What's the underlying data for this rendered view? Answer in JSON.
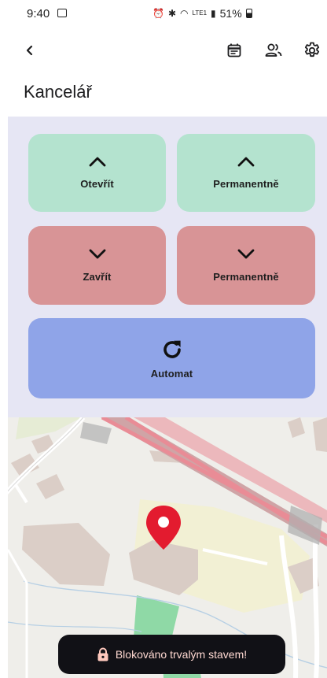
{
  "status_bar": {
    "time": "9:40",
    "battery": "51%",
    "network": "LTE1"
  },
  "app_bar": {
    "back_icon": "chevron-left-icon",
    "actions": [
      "calendar-icon",
      "people-icon",
      "gear-icon"
    ]
  },
  "page": {
    "title": "Kancelář"
  },
  "controls": {
    "open": {
      "label": "Otevřít",
      "icon": "chevron-up-icon"
    },
    "open_permanent": {
      "label": "Permanentně",
      "icon": "chevron-up-icon"
    },
    "close": {
      "label": "Zavřít",
      "icon": "chevron-down-icon"
    },
    "close_permanent": {
      "label": "Permanentně",
      "icon": "chevron-down-icon"
    },
    "automat": {
      "label": "Automat",
      "icon": "refresh-icon"
    }
  },
  "colors": {
    "open": "#b4e3cf",
    "close": "#d89496",
    "automat": "#8fa4e8",
    "panel": "#e6e6f4",
    "map_pin": "#e31b2f"
  },
  "toast": {
    "icon": "lock-icon",
    "text": "Blokováno trvalým stavem!"
  }
}
